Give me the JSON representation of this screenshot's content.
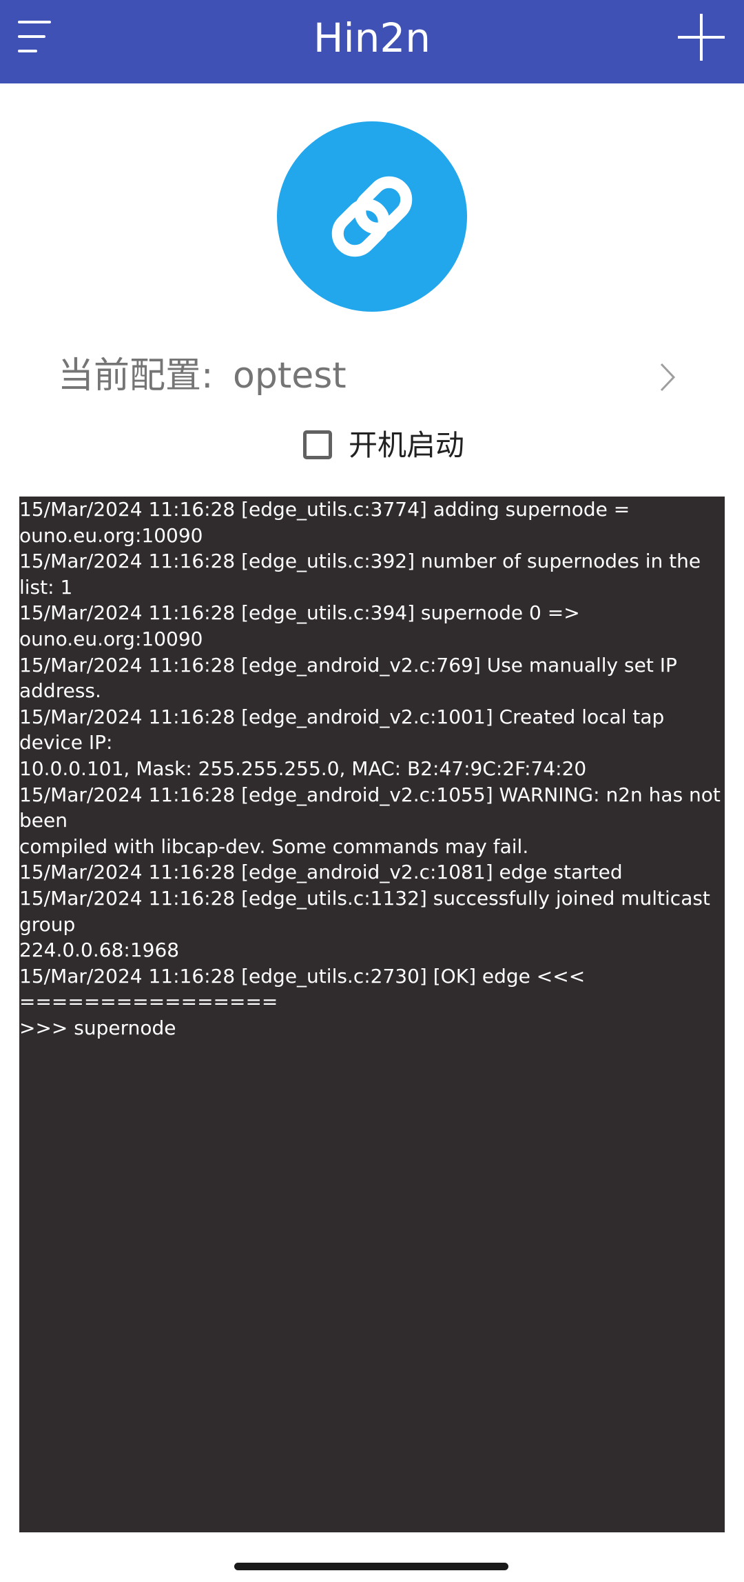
{
  "app_bar": {
    "title": "Hin2n",
    "background_color": "#3f51b5",
    "menu_icon": "hamburger-menu-icon",
    "add_icon": "plus-icon"
  },
  "connect_button": {
    "icon": "link-icon",
    "color": "#22a6ec"
  },
  "config": {
    "label": "当前配置:",
    "value": "optest",
    "chevron_icon": "chevron-right-icon"
  },
  "boot_start": {
    "label": "开机启动",
    "checked": false
  },
  "log": {
    "background_color": "#302b2c",
    "text": "15/Mar/2024 11:16:28 [edge_utils.c:3774] adding supernode =\nouno.eu.org:10090\n15/Mar/2024 11:16:28 [edge_utils.c:392] number of supernodes in the list: 1\n15/Mar/2024 11:16:28 [edge_utils.c:394] supernode 0 => ouno.eu.org:10090\n15/Mar/2024 11:16:28 [edge_android_v2.c:769] Use manually set IP address.\n15/Mar/2024 11:16:28 [edge_android_v2.c:1001] Created local tap device IP:\n10.0.0.101, Mask: 255.255.255.0, MAC: B2:47:9C:2F:74:20\n15/Mar/2024 11:16:28 [edge_android_v2.c:1055] WARNING: n2n has not been\ncompiled with libcap-dev. Some commands may fail.\n15/Mar/2024 11:16:28 [edge_android_v2.c:1081] edge started\n15/Mar/2024 11:16:28 [edge_utils.c:1132] successfully joined multicast group\n224.0.0.68:1968\n15/Mar/2024 11:16:28 [edge_utils.c:2730] [OK] edge <<< ================\n>>> supernode"
  }
}
